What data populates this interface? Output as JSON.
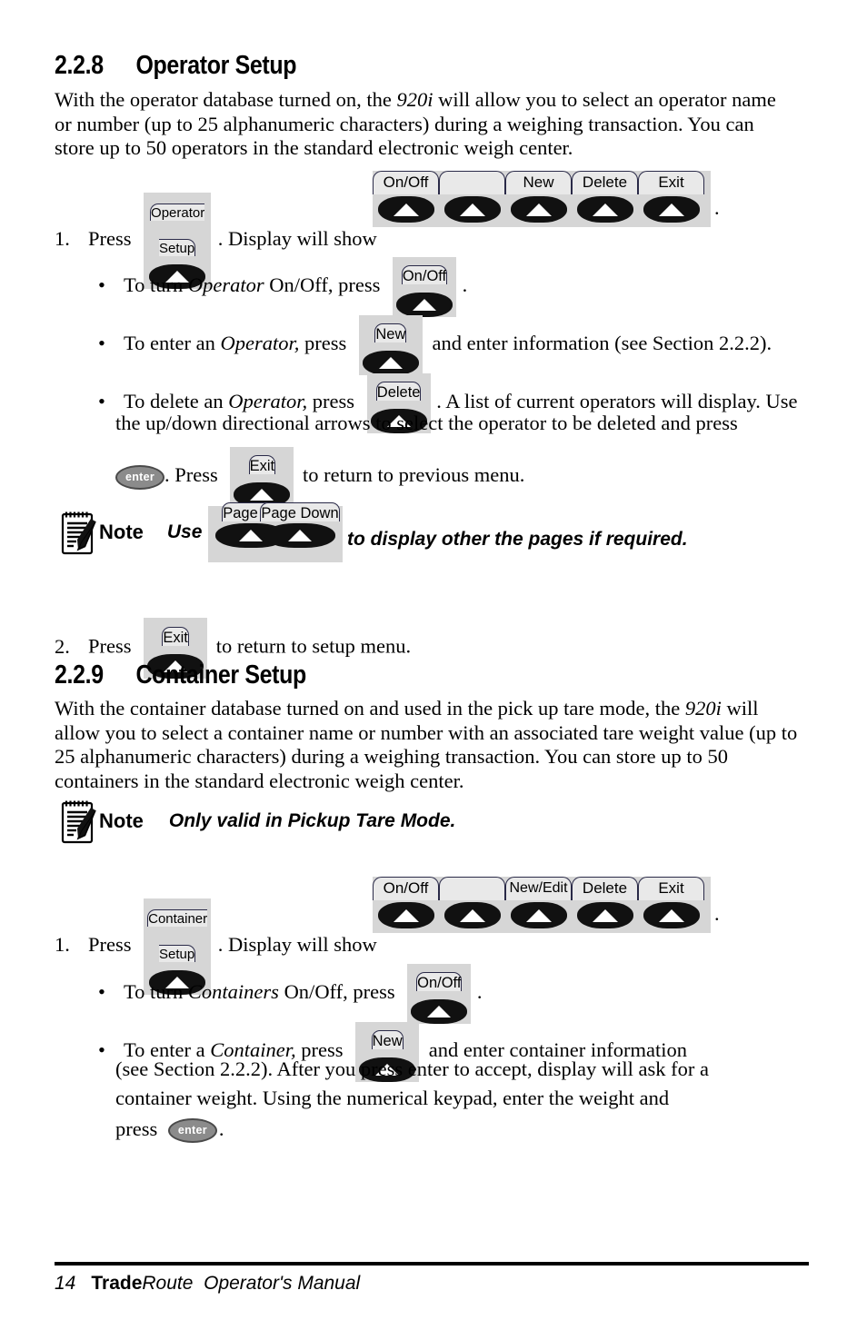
{
  "document": {
    "footer": {
      "page_number": "14",
      "brand_bold": "Trade",
      "brand_rest": "Route",
      "manual_title": "Operator's Manual"
    }
  },
  "sections": [
    {
      "number": "2.2.8",
      "title": "Operator Setup",
      "intro": "With the operator database turned on, the 920i will allow you to select an operator name or number (up to 25 alphanumeric characters) during a weighing transaction. You can store up to 50 operators in the standard electronic weigh center.",
      "intro_parts": {
        "p1": "With the operator database turned on, the ",
        "em1": "920i",
        "p2": " will allow you to select an operator name or number (up to 25 alphanumeric characters) during a weighing transaction. You can store up to 50 operators in the standard electronic weigh center."
      }
    },
    {
      "number": "2.2.9",
      "title": "Container Setup",
      "intro_parts": {
        "p1": "With the container database turned on and used in the pick up tare mode, the ",
        "em1": "920i",
        "p2": " will allow you to select a container name or number with an associated tare weight value (up to 25 alphanumeric characters) during a weighing transaction. You can store up to 50 containers in the standard electronic weigh center."
      }
    }
  ],
  "operator_steps": {
    "step1": {
      "marker": "1.",
      "text_before": "Press",
      "key": {
        "line1": "Operator",
        "line2": "Setup",
        "icon": "up-arrow-softkey"
      },
      "text_after": ". Display will show",
      "text_end": "."
    },
    "bullets": [
      {
        "marker": "•",
        "before_1": "To turn ",
        "italic": "Operator",
        "before_2": " On/Off, press",
        "key": {
          "label": "On/Off",
          "icon": "up-arrow-softkey"
        },
        "after": "."
      },
      {
        "marker": "•",
        "before_1": "To enter an ",
        "italic": "Operator,",
        "before_2": " press",
        "key": {
          "label": "New",
          "icon": "up-arrow-softkey"
        },
        "after": "and enter information (see Section 2.2.2)."
      },
      {
        "marker": "•",
        "before_1": "To delete an ",
        "italic": "Operator,",
        "before_2": " press",
        "key": {
          "label": "Delete",
          "icon": "up-arrow-softkey"
        },
        "after": ". A list of current operators will display. Use",
        "line2": "the up/down directional arrows to select the operator to be deleted and press",
        "line3_enter": "enter",
        "line3_mid": ". Press",
        "line3_key": {
          "label": "Exit",
          "icon": "up-arrow-softkey"
        },
        "line3_end": "to return to previous menu."
      }
    ],
    "note": {
      "icon": "notepad-pencil-icon",
      "label": "Note",
      "text_before": "Use",
      "keys": [
        {
          "label": "Page up",
          "icon": "up-arrow-softkey"
        },
        {
          "label": "Page Down",
          "icon": "up-arrow-softkey"
        }
      ],
      "text_after": "to display other the pages if required."
    },
    "step2": {
      "marker": "2.",
      "text_before": "Press",
      "key": {
        "label": "Exit",
        "icon": "up-arrow-softkey"
      },
      "text_after": "to return to setup menu."
    }
  },
  "container_steps": {
    "note": {
      "icon": "notepad-pencil-icon",
      "label": "Note",
      "text": "Only valid in Pickup Tare Mode."
    },
    "step1": {
      "marker": "1.",
      "text_before": "Press",
      "key": {
        "line1": "Container",
        "line2": "Setup",
        "icon": "up-arrow-softkey"
      },
      "text_after": ". Display will show",
      "text_end": "."
    },
    "bullets": [
      {
        "marker": "•",
        "before_1": "To turn ",
        "italic": "Containers",
        "before_2": " On/Off, press",
        "key": {
          "label": "On/Off",
          "icon": "up-arrow-softkey"
        },
        "after": "."
      },
      {
        "marker": "•",
        "before_1": "To enter a ",
        "italic": "Container,",
        "before_2": " press",
        "key": {
          "label": "New",
          "icon": "up-arrow-softkey"
        },
        "after": "and enter container information",
        "line2": "(see Section 2.2.2). After you press enter to accept, display will ask for a",
        "line3": "container weight. Using the numerical keypad, enter the weight and",
        "line4_before": "press",
        "line4_enter": "enter",
        "line4_end": "."
      }
    ]
  },
  "display_strips": {
    "operator": {
      "keys": [
        {
          "label": "On/Off"
        },
        {
          "label": ""
        },
        {
          "label": "New"
        },
        {
          "label": "Delete"
        },
        {
          "label": "Exit"
        }
      ]
    },
    "container": {
      "keys": [
        {
          "label": "On/Off"
        },
        {
          "label": ""
        },
        {
          "label": "New/Edit"
        },
        {
          "label": "Delete"
        },
        {
          "label": "Exit"
        }
      ]
    }
  },
  "colors": {
    "strip_background": "#d6d6d6",
    "tab_fill": "#e9e9e9",
    "tab_border": "#2a2a48",
    "button_fill": "#111111",
    "triangle": "#ffffff",
    "enter_fill": "#8b8b8b"
  }
}
